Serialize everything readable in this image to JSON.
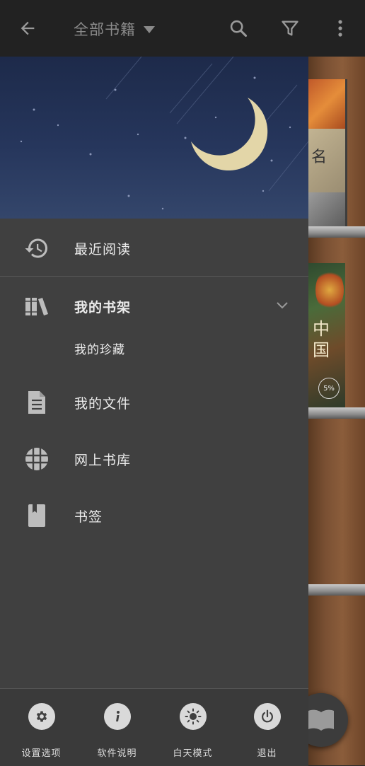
{
  "topbar": {
    "title": "全部书籍",
    "back_icon": "arrow-left-icon",
    "search_icon": "search-icon",
    "filter_icon": "filter-icon",
    "more_icon": "more-vert-icon"
  },
  "shelf": {
    "book1_glyph": "名",
    "book2_glyph": "中国",
    "book2_progress": "5%"
  },
  "drawer": {
    "items": [
      {
        "label": "最近阅读",
        "icon": "history-icon"
      },
      {
        "label": "我的书架",
        "icon": "bookshelf-icon",
        "expanded": true
      },
      {
        "label": "我的珍藏",
        "icon": null
      },
      {
        "label": "我的文件",
        "icon": "document-icon"
      },
      {
        "label": "网上书库",
        "icon": "globe-icon"
      },
      {
        "label": "书签",
        "icon": "bookmark-icon"
      }
    ],
    "bottom": [
      {
        "label": "设置选项",
        "icon": "gear-icon"
      },
      {
        "label": "软件说明",
        "icon": "info-icon"
      },
      {
        "label": "白天模式",
        "icon": "sun-icon"
      },
      {
        "label": "退出",
        "icon": "power-icon"
      }
    ]
  },
  "colors": {
    "topbar_bg": "#222222",
    "drawer_bg": "#404040",
    "header_night": "#26365c",
    "moon": "#e3d6a8"
  }
}
